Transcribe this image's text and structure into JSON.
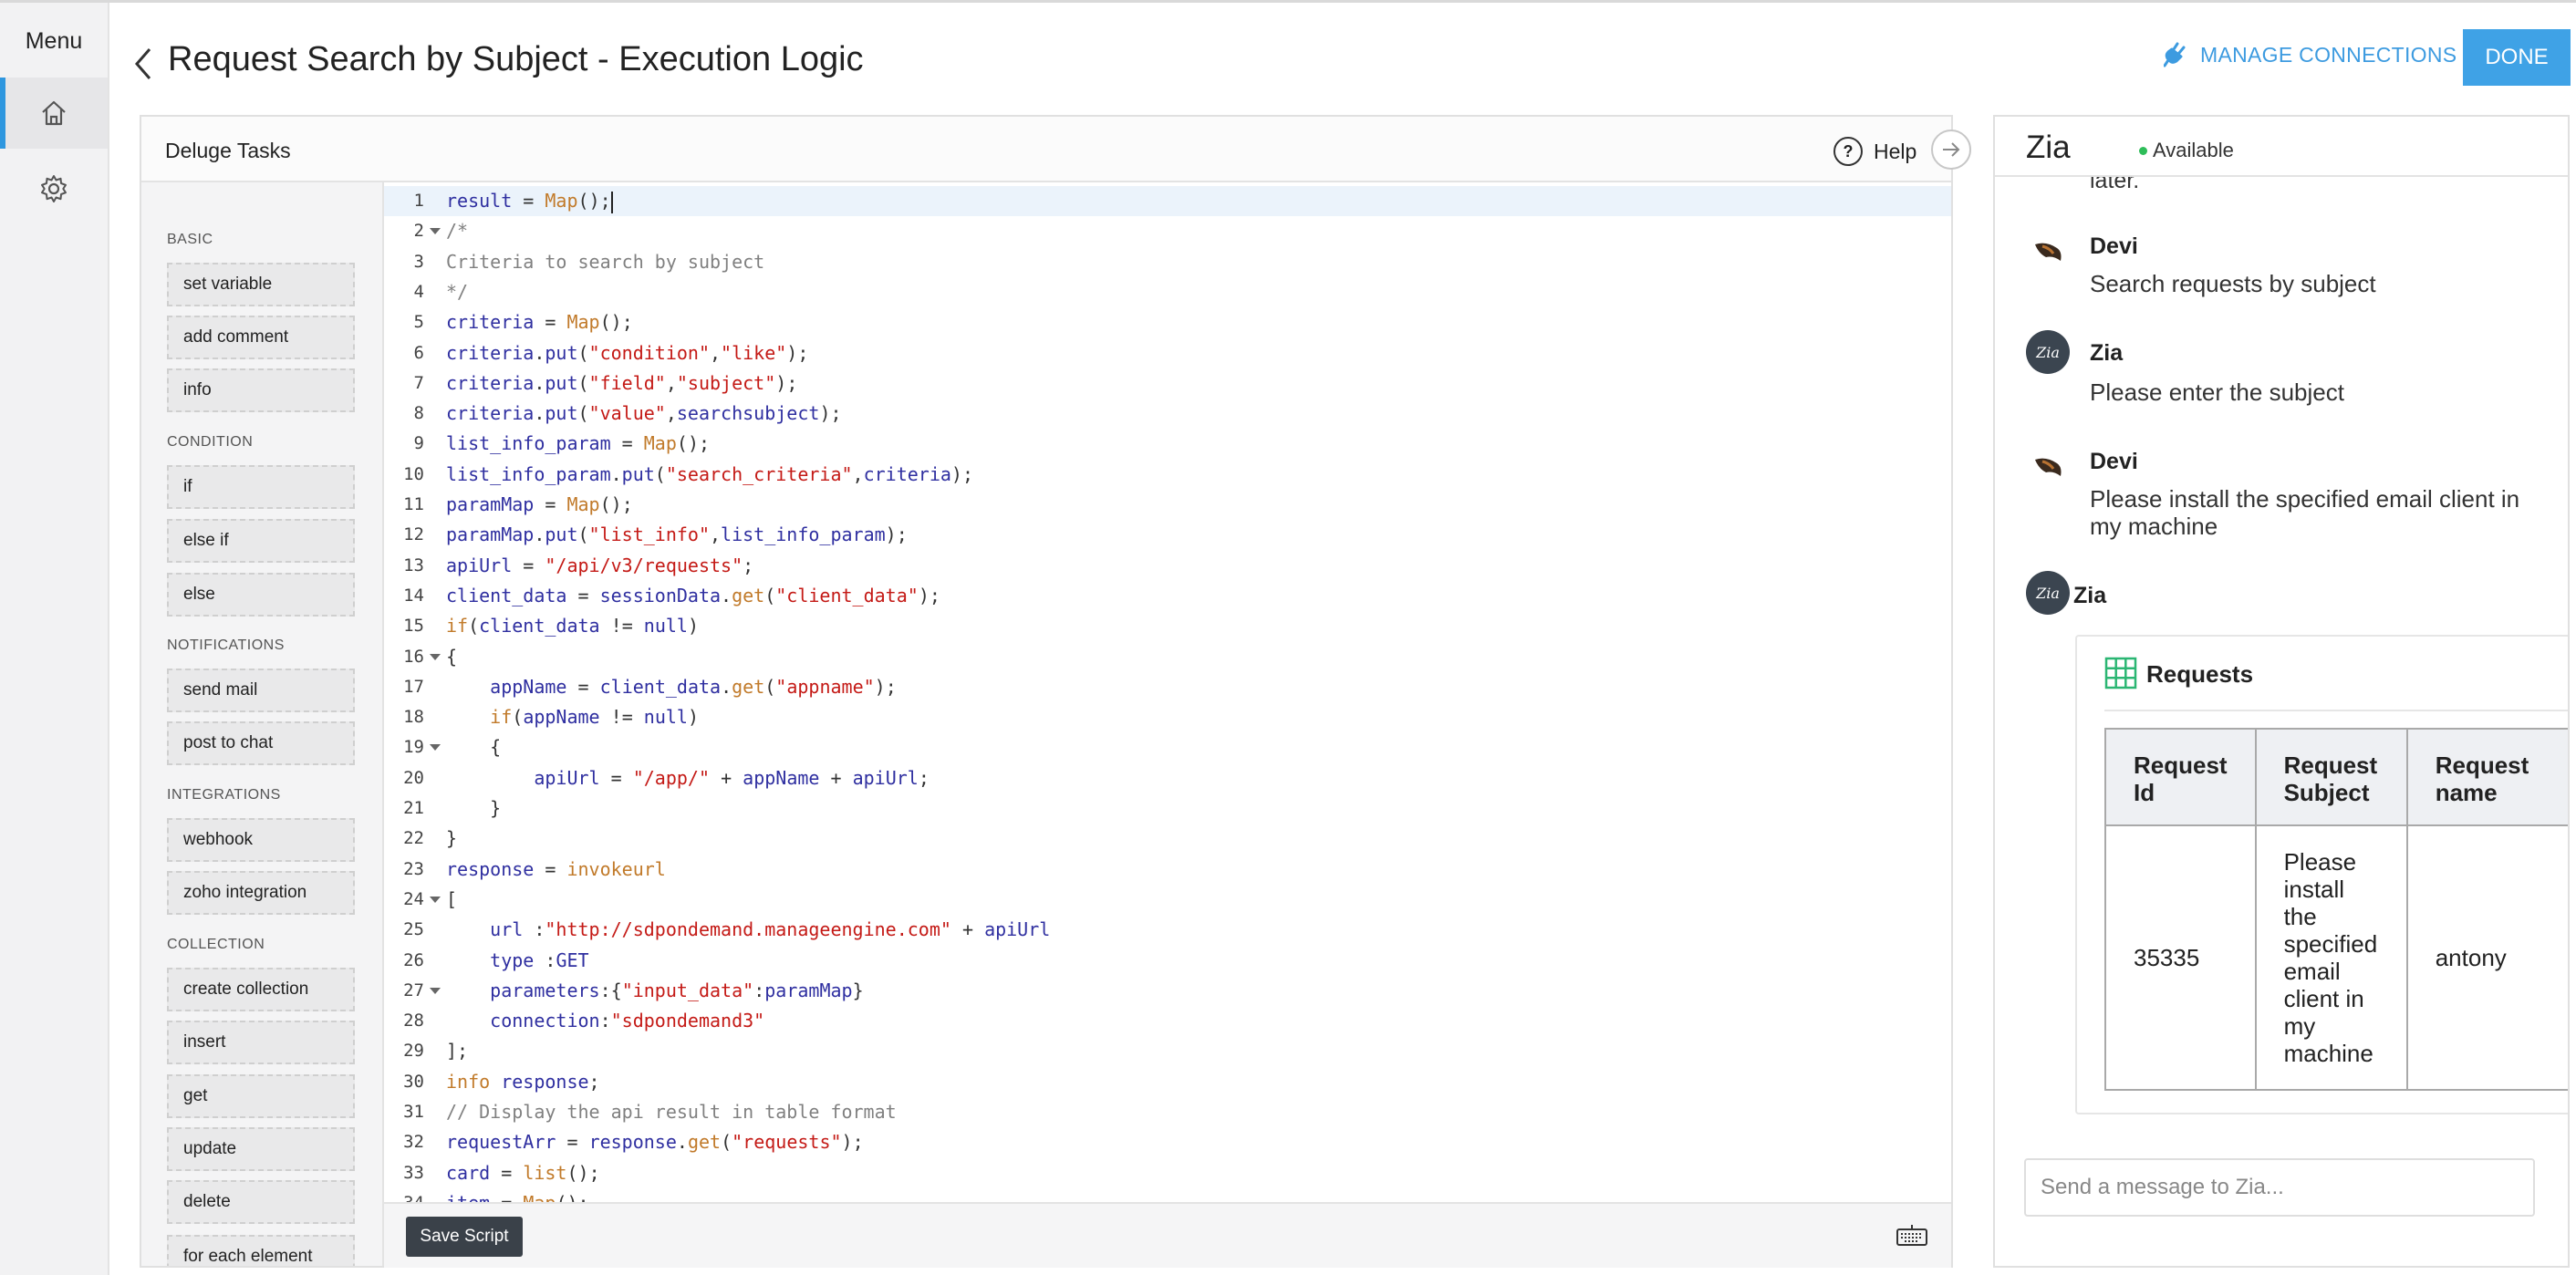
{
  "rail": {
    "menu_label": "Menu"
  },
  "header": {
    "title": "Request Search by Subject - Execution Logic",
    "manage_connections": "MANAGE CONNECTIONS",
    "done": "DONE"
  },
  "deluge": {
    "title": "Deluge Tasks",
    "help": "Help",
    "save_script": "Save Script",
    "palette": [
      {
        "section": "BASIC",
        "items": [
          "set variable",
          "add comment",
          "info"
        ]
      },
      {
        "section": "CONDITION",
        "items": [
          "if",
          "else if",
          "else"
        ]
      },
      {
        "section": "NOTIFICATIONS",
        "items": [
          "send mail",
          "post to chat"
        ]
      },
      {
        "section": "INTEGRATIONS",
        "items": [
          "webhook",
          "zoho integration"
        ]
      },
      {
        "section": "COLLECTION",
        "items": [
          "create collection",
          "insert",
          "get",
          "update",
          "delete",
          "for each element"
        ]
      }
    ],
    "code_lines": [
      "result = Map();",
      "/*",
      "Criteria to search by subject",
      "*/",
      "criteria = Map();",
      "criteria.put(\"condition\",\"like\");",
      "criteria.put(\"field\",\"subject\");",
      "criteria.put(\"value\",searchsubject);",
      "list_info_param = Map();",
      "list_info_param.put(\"search_criteria\",criteria);",
      "paramMap = Map();",
      "paramMap.put(\"list_info\",list_info_param);",
      "apiUrl = \"/api/v3/requests\";",
      "client_data = sessionData.get(\"client_data\");",
      "if(client_data != null)",
      "{",
      "    appName = client_data.get(\"appname\");",
      "    if(appName != null)",
      "    {",
      "        apiUrl = \"/app/\" + appName + apiUrl;",
      "    }",
      "}",
      "response = invokeurl",
      "[",
      "    url :\"http://sdpondemand.manageengine.com\" + apiUrl",
      "    type :GET",
      "    parameters:{\"input_data\":paramMap}",
      "    connection:\"sdpondemand3\"",
      "];",
      "info response;",
      "// Display the api result in table format",
      "requestArr = response.get(\"requests\");",
      "card = list();",
      "item = Map();"
    ]
  },
  "zia": {
    "title": "Zia",
    "status": "Available",
    "cut_text": "later.",
    "messages": [
      {
        "author": "Devi",
        "text": "Search requests by subject"
      },
      {
        "author": "Zia",
        "text": "Please enter the subject"
      },
      {
        "author": "Devi",
        "text": "Please install the specified email client in my machine"
      },
      {
        "author": "Zia",
        "text": ""
      }
    ],
    "card": {
      "title": "Requests",
      "headers": [
        "Request Id",
        "Request Subject",
        "Request name"
      ],
      "row": [
        "35335",
        "Please install the specified email client in my machine",
        "antony"
      ]
    },
    "input_placeholder": "Send a message to Zia..."
  },
  "colors": {
    "accent": "#3fa2e6",
    "available": "#2ebd59",
    "code_string": "#c41a16",
    "code_ident": "#2f2fa0",
    "code_func": "#c17a2a"
  }
}
